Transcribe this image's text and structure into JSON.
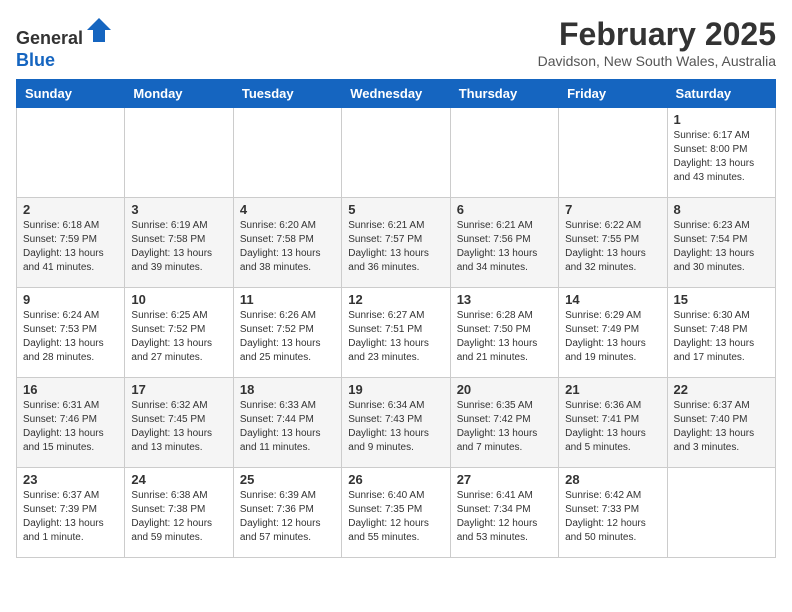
{
  "header": {
    "logo_general": "General",
    "logo_blue": "Blue",
    "month_title": "February 2025",
    "location": "Davidson, New South Wales, Australia"
  },
  "days_of_week": [
    "Sunday",
    "Monday",
    "Tuesday",
    "Wednesday",
    "Thursday",
    "Friday",
    "Saturday"
  ],
  "weeks": [
    [
      {
        "day": "",
        "info": ""
      },
      {
        "day": "",
        "info": ""
      },
      {
        "day": "",
        "info": ""
      },
      {
        "day": "",
        "info": ""
      },
      {
        "day": "",
        "info": ""
      },
      {
        "day": "",
        "info": ""
      },
      {
        "day": "1",
        "info": "Sunrise: 6:17 AM\nSunset: 8:00 PM\nDaylight: 13 hours\nand 43 minutes."
      }
    ],
    [
      {
        "day": "2",
        "info": "Sunrise: 6:18 AM\nSunset: 7:59 PM\nDaylight: 13 hours\nand 41 minutes."
      },
      {
        "day": "3",
        "info": "Sunrise: 6:19 AM\nSunset: 7:58 PM\nDaylight: 13 hours\nand 39 minutes."
      },
      {
        "day": "4",
        "info": "Sunrise: 6:20 AM\nSunset: 7:58 PM\nDaylight: 13 hours\nand 38 minutes."
      },
      {
        "day": "5",
        "info": "Sunrise: 6:21 AM\nSunset: 7:57 PM\nDaylight: 13 hours\nand 36 minutes."
      },
      {
        "day": "6",
        "info": "Sunrise: 6:21 AM\nSunset: 7:56 PM\nDaylight: 13 hours\nand 34 minutes."
      },
      {
        "day": "7",
        "info": "Sunrise: 6:22 AM\nSunset: 7:55 PM\nDaylight: 13 hours\nand 32 minutes."
      },
      {
        "day": "8",
        "info": "Sunrise: 6:23 AM\nSunset: 7:54 PM\nDaylight: 13 hours\nand 30 minutes."
      }
    ],
    [
      {
        "day": "9",
        "info": "Sunrise: 6:24 AM\nSunset: 7:53 PM\nDaylight: 13 hours\nand 28 minutes."
      },
      {
        "day": "10",
        "info": "Sunrise: 6:25 AM\nSunset: 7:52 PM\nDaylight: 13 hours\nand 27 minutes."
      },
      {
        "day": "11",
        "info": "Sunrise: 6:26 AM\nSunset: 7:52 PM\nDaylight: 13 hours\nand 25 minutes."
      },
      {
        "day": "12",
        "info": "Sunrise: 6:27 AM\nSunset: 7:51 PM\nDaylight: 13 hours\nand 23 minutes."
      },
      {
        "day": "13",
        "info": "Sunrise: 6:28 AM\nSunset: 7:50 PM\nDaylight: 13 hours\nand 21 minutes."
      },
      {
        "day": "14",
        "info": "Sunrise: 6:29 AM\nSunset: 7:49 PM\nDaylight: 13 hours\nand 19 minutes."
      },
      {
        "day": "15",
        "info": "Sunrise: 6:30 AM\nSunset: 7:48 PM\nDaylight: 13 hours\nand 17 minutes."
      }
    ],
    [
      {
        "day": "16",
        "info": "Sunrise: 6:31 AM\nSunset: 7:46 PM\nDaylight: 13 hours\nand 15 minutes."
      },
      {
        "day": "17",
        "info": "Sunrise: 6:32 AM\nSunset: 7:45 PM\nDaylight: 13 hours\nand 13 minutes."
      },
      {
        "day": "18",
        "info": "Sunrise: 6:33 AM\nSunset: 7:44 PM\nDaylight: 13 hours\nand 11 minutes."
      },
      {
        "day": "19",
        "info": "Sunrise: 6:34 AM\nSunset: 7:43 PM\nDaylight: 13 hours\nand 9 minutes."
      },
      {
        "day": "20",
        "info": "Sunrise: 6:35 AM\nSunset: 7:42 PM\nDaylight: 13 hours\nand 7 minutes."
      },
      {
        "day": "21",
        "info": "Sunrise: 6:36 AM\nSunset: 7:41 PM\nDaylight: 13 hours\nand 5 minutes."
      },
      {
        "day": "22",
        "info": "Sunrise: 6:37 AM\nSunset: 7:40 PM\nDaylight: 13 hours\nand 3 minutes."
      }
    ],
    [
      {
        "day": "23",
        "info": "Sunrise: 6:37 AM\nSunset: 7:39 PM\nDaylight: 13 hours\nand 1 minute."
      },
      {
        "day": "24",
        "info": "Sunrise: 6:38 AM\nSunset: 7:38 PM\nDaylight: 12 hours\nand 59 minutes."
      },
      {
        "day": "25",
        "info": "Sunrise: 6:39 AM\nSunset: 7:36 PM\nDaylight: 12 hours\nand 57 minutes."
      },
      {
        "day": "26",
        "info": "Sunrise: 6:40 AM\nSunset: 7:35 PM\nDaylight: 12 hours\nand 55 minutes."
      },
      {
        "day": "27",
        "info": "Sunrise: 6:41 AM\nSunset: 7:34 PM\nDaylight: 12 hours\nand 53 minutes."
      },
      {
        "day": "28",
        "info": "Sunrise: 6:42 AM\nSunset: 7:33 PM\nDaylight: 12 hours\nand 50 minutes."
      },
      {
        "day": "",
        "info": ""
      }
    ]
  ]
}
